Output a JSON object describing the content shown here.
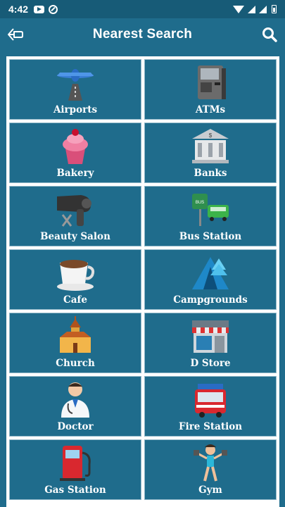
{
  "status_bar": {
    "time": "4:42"
  },
  "app_bar": {
    "title": "Nearest Search"
  },
  "categories": [
    {
      "label": "Airports",
      "icon": "airplane-icon"
    },
    {
      "label": "ATMs",
      "icon": "atm-icon"
    },
    {
      "label": "Bakery",
      "icon": "cupcake-icon"
    },
    {
      "label": "Banks",
      "icon": "bank-icon"
    },
    {
      "label": "Beauty Salon",
      "icon": "hair-dryer-icon"
    },
    {
      "label": "Bus Station",
      "icon": "bus-stop-icon"
    },
    {
      "label": "Cafe",
      "icon": "coffee-cup-icon"
    },
    {
      "label": "Campgrounds",
      "icon": "tent-icon"
    },
    {
      "label": "Church",
      "icon": "church-icon"
    },
    {
      "label": "D Store",
      "icon": "store-icon"
    },
    {
      "label": "Doctor",
      "icon": "doctor-icon"
    },
    {
      "label": "Fire Station",
      "icon": "fire-truck-icon"
    },
    {
      "label": "Gas Station",
      "icon": "gas-pump-icon"
    },
    {
      "label": "Gym",
      "icon": "fitness-icon"
    }
  ],
  "colors": {
    "primary": "#1f6c8c",
    "status_bar": "#175b77",
    "frame": "#ffffff"
  }
}
